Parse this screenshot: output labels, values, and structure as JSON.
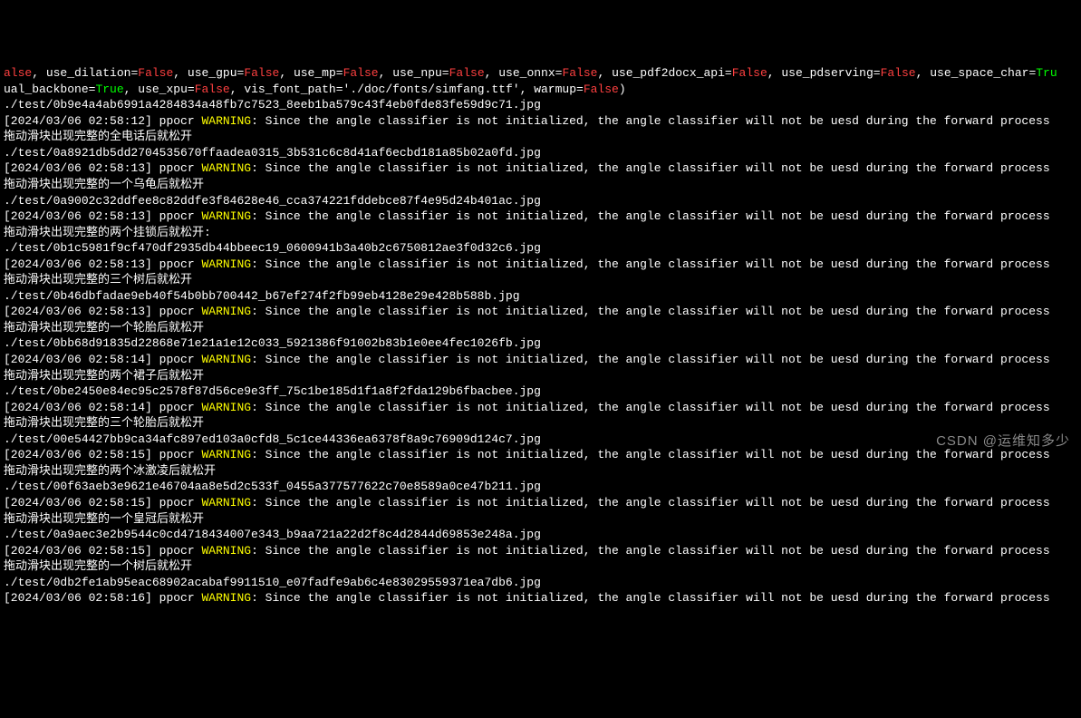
{
  "config_line": {
    "prefix": "alse",
    "use_dilation": {
      "label": "use_dilation",
      "value": "False"
    },
    "use_gpu": {
      "label": "use_gpu",
      "value": "False"
    },
    "use_mp": {
      "label": "use_mp",
      "value": "False"
    },
    "use_npu": {
      "label": "use_npu",
      "value": "False"
    },
    "use_onnx": {
      "label": "use_onnx",
      "value": "False"
    },
    "use_pdf2docx_api": {
      "label": "use_pdf2docx_api",
      "value": "False"
    },
    "use_pdserving": {
      "label": "use_pdserving",
      "value": "False"
    },
    "use_space_char": {
      "label": "use_space_char",
      "value": "Tru"
    },
    "ual_backbone_label": "ual_backbone",
    "ual_backbone_value": "True",
    "use_xpu": {
      "label": "use_xpu",
      "value": "False"
    },
    "vis_font_path_label": "vis_font_path",
    "vis_font_path_value": "'./doc/fonts/simfang.ttf'",
    "warmup_label": "warmup",
    "warmup_value": "False",
    "close_paren": ")"
  },
  "warning_msg": ": Since the angle classifier is not initialized, the angle classifier will not be uesd during the forward process",
  "ppocr": "ppocr",
  "warning_label": "WARNING",
  "entries": [
    {
      "path": "./test/0b9e4a4ab6991a4284834a48fb7c7523_8eeb1ba579c43f4eb0fde83fe59d9c71.jpg",
      "ts": "[2024/03/06 02:58:12]",
      "result": "拖动滑块出现完整的全电话后就松开"
    },
    {
      "path": "./test/0a8921db5dd2704535670ffaadea0315_3b531c6c8d41af6ecbd181a85b02a0fd.jpg",
      "ts": "[2024/03/06 02:58:13]",
      "result": "拖动滑块出现完整的一个乌龟后就松开"
    },
    {
      "path": "./test/0a9002c32ddfee8c82ddfe3f84628e46_cca374221fddebce87f4e95d24b401ac.jpg",
      "ts": "[2024/03/06 02:58:13]",
      "result": "拖动滑块出现完整的两个挂锁后就松开:"
    },
    {
      "path": "./test/0b1c5981f9cf470df2935db44bbeec19_0600941b3a40b2c6750812ae3f0d32c6.jpg",
      "ts": "[2024/03/06 02:58:13]",
      "result": "拖动滑块出现完整的三个树后就松开"
    },
    {
      "path": "./test/0b46dbfadae9eb40f54b0bb700442_b67ef274f2fb99eb4128e29e428b588b.jpg",
      "ts": "[2024/03/06 02:58:13]",
      "result": "拖动滑块出现完整的一个轮胎后就松开"
    },
    {
      "path": "./test/0bb68d91835d22868e71e21a1e12c033_5921386f91002b83b1e0ee4fec1026fb.jpg",
      "ts": "[2024/03/06 02:58:14]",
      "result": "拖动滑块出现完整的两个裙子后就松开"
    },
    {
      "path": "./test/0be2450e84ec95c2578f87d56ce9e3ff_75c1be185d1f1a8f2fda129b6fbacbee.jpg",
      "ts": "[2024/03/06 02:58:14]",
      "result": "拖动滑块出现完整的三个轮胎后就松开"
    },
    {
      "path": "./test/00e54427bb9ca34afc897ed103a0cfd8_5c1ce44336ea6378f8a9c76909d124c7.jpg",
      "ts": "[2024/03/06 02:58:15]",
      "result": "拖动滑块出现完整的两个冰激凌后就松开"
    },
    {
      "path": "./test/00f63aeb3e9621e46704aa8e5d2c533f_0455a377577622c70e8589a0ce47b211.jpg",
      "ts": "[2024/03/06 02:58:15]",
      "result": "拖动滑块出现完整的一个皇冠后就松开"
    },
    {
      "path": "./test/0a9aec3e2b9544c0cd4718434007e343_b9aa721a22d2f8c4d2844d69853e248a.jpg",
      "ts": "[2024/03/06 02:58:15]",
      "result": "拖动滑块出现完整的一个树后就松开"
    }
  ],
  "last_path": "./test/0db2fe1ab95eac68902acabaf9911510_e07fadfe9ab6c4e83029559371ea7db6.jpg",
  "last_ts": "[2024/03/06 02:58:16]",
  "watermark": "CSDN @运维知多少"
}
